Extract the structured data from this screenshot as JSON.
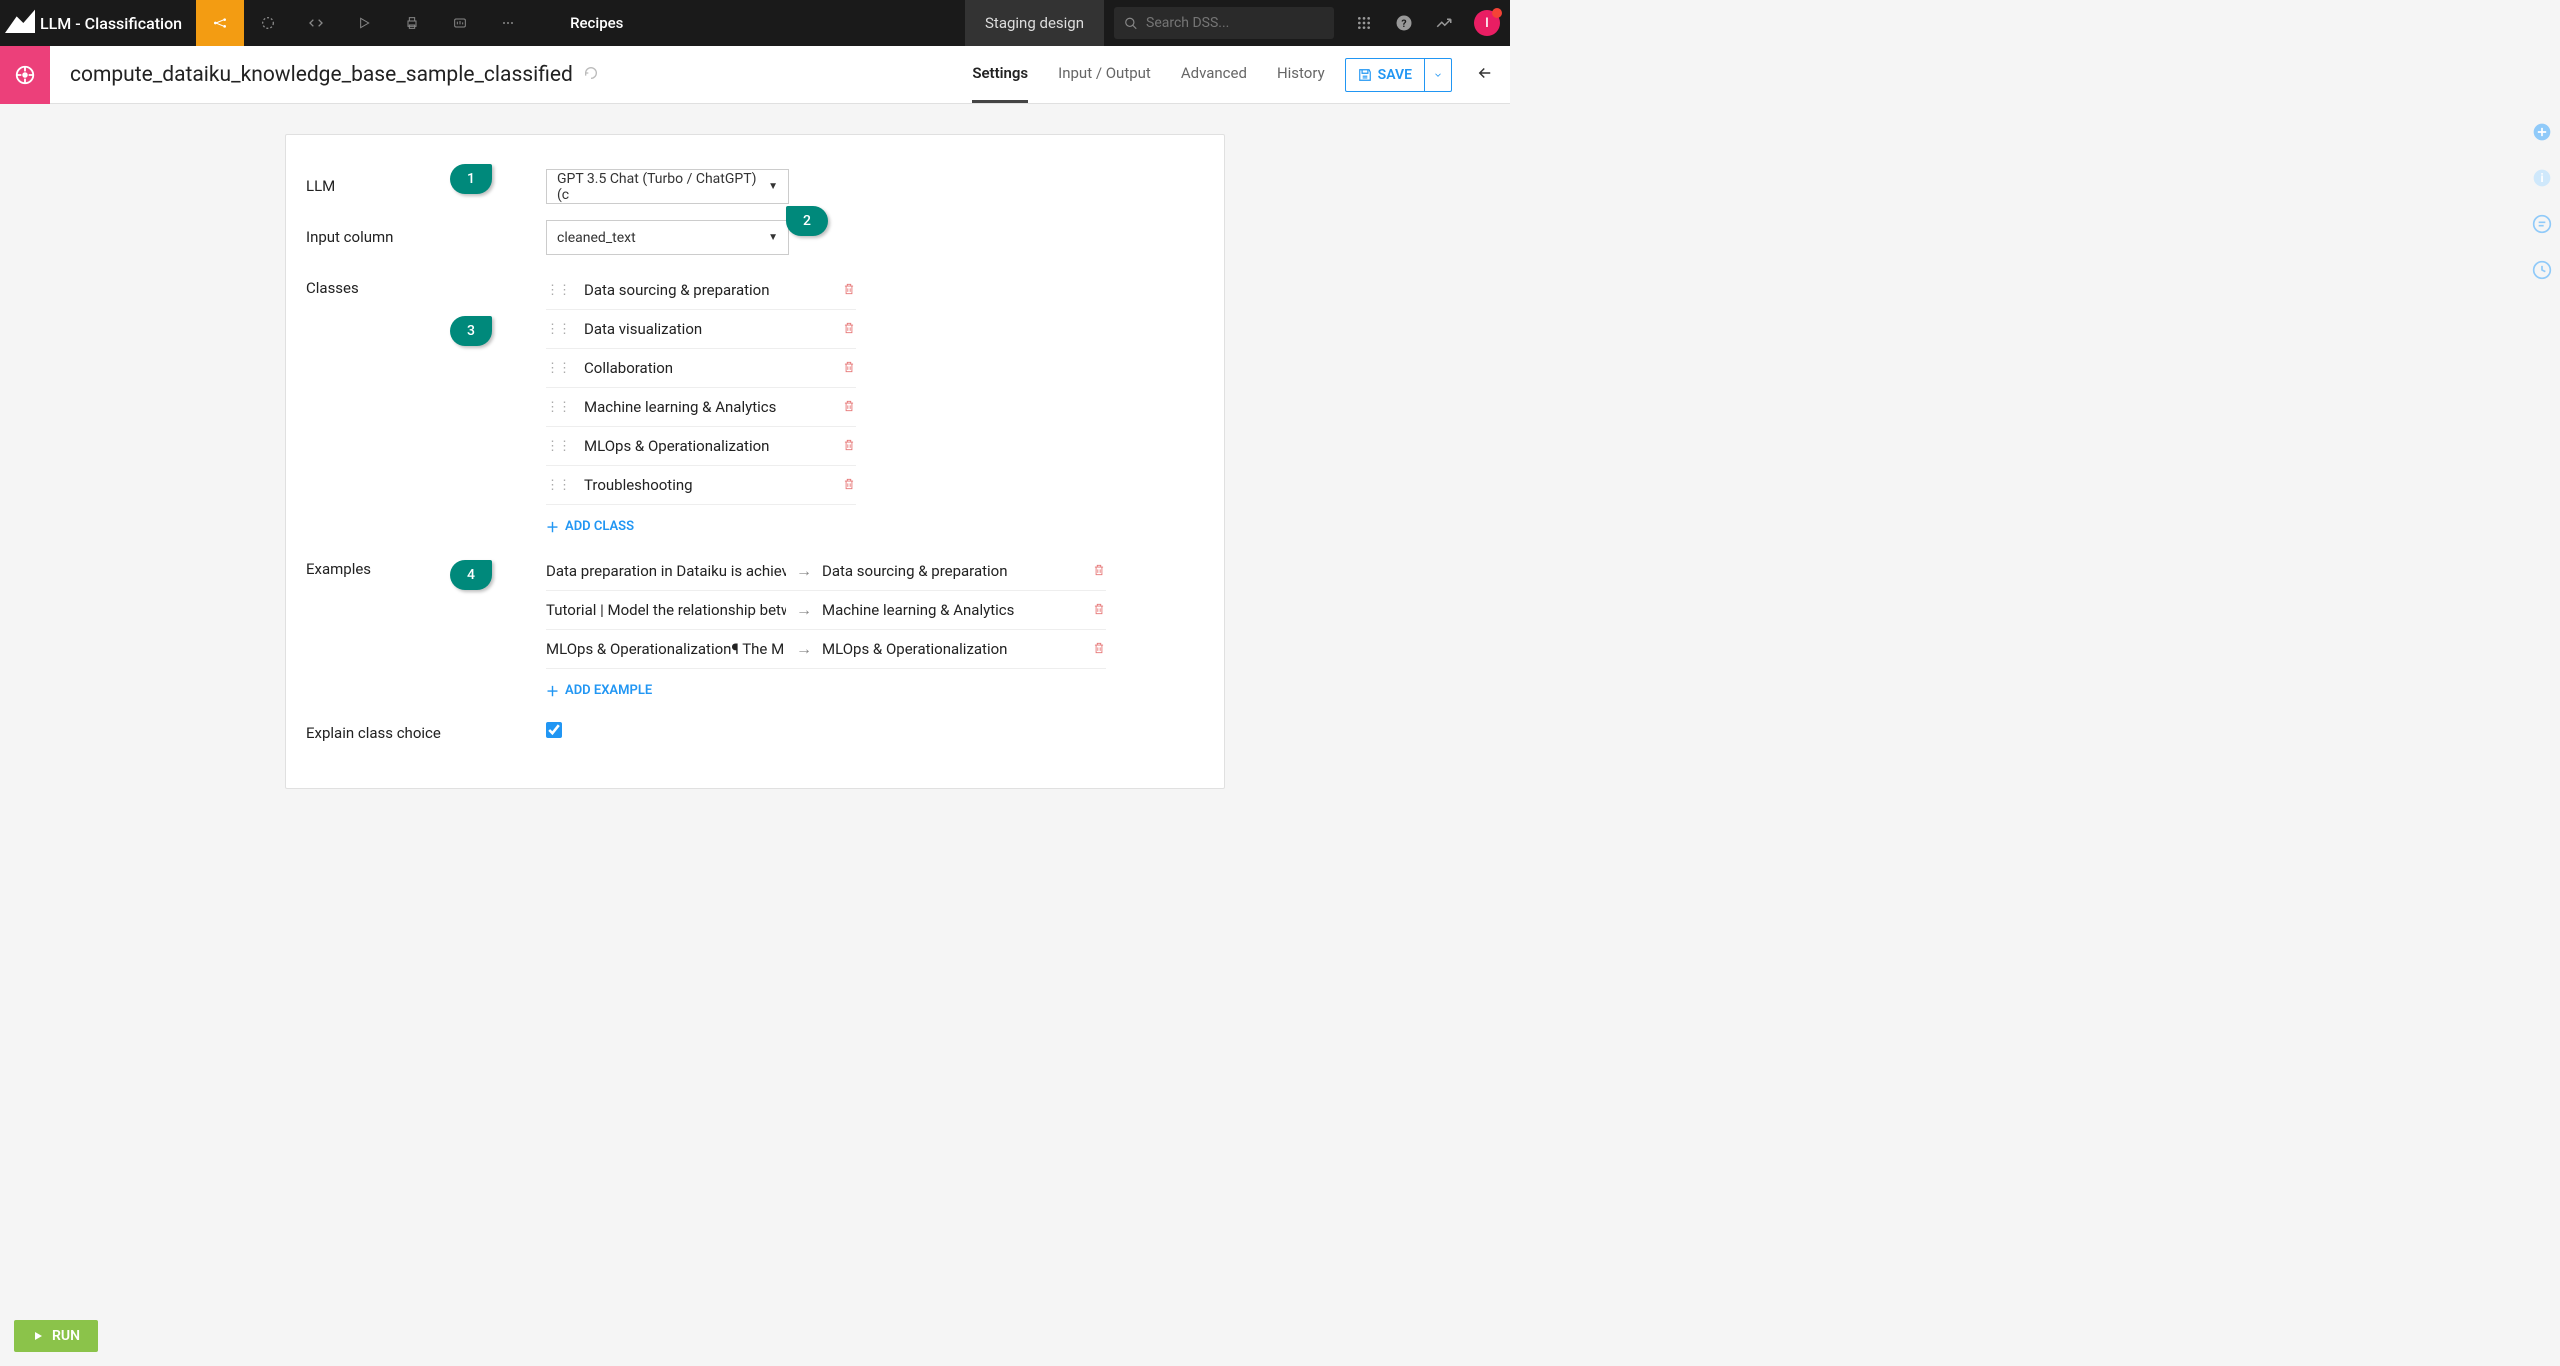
{
  "topbar": {
    "title": "LLM - Classification",
    "recipes_label": "Recipes",
    "staging": "Staging design",
    "search_placeholder": "Search DSS...",
    "avatar_letter": "I"
  },
  "subheader": {
    "name": "compute_dataiku_knowledge_base_sample_classified",
    "tabs": [
      "Settings",
      "Input / Output",
      "Advanced",
      "History"
    ],
    "active_tab": "Settings",
    "save_label": "SAVE"
  },
  "form": {
    "llm_label": "LLM",
    "llm_value": "GPT 3.5 Chat (Turbo / ChatGPT) (c",
    "input_col_label": "Input column",
    "input_col_value": "cleaned_text",
    "classes_label": "Classes",
    "classes": [
      "Data sourcing  & preparation",
      "Data visualization",
      "Collaboration",
      "Machine learning & Analytics",
      "MLOps & Operationalization",
      "Troubleshooting"
    ],
    "add_class": "ADD CLASS",
    "examples_label": "Examples",
    "examples": [
      {
        "in": "Data preparation in Dataiku is achiev",
        "out": "Data sourcing  & preparation"
      },
      {
        "in": "Tutorial | Model the relationship betw",
        "out": "Machine learning & Analytics"
      },
      {
        "in": "MLOps & Operationalization¶  The M",
        "out": "MLOps & Operationalization"
      }
    ],
    "add_example": "ADD EXAMPLE",
    "explain_label": "Explain class choice"
  },
  "callouts": {
    "c1": "1",
    "c2": "2",
    "c3": "3",
    "c4": "4"
  },
  "run_label": "RUN"
}
